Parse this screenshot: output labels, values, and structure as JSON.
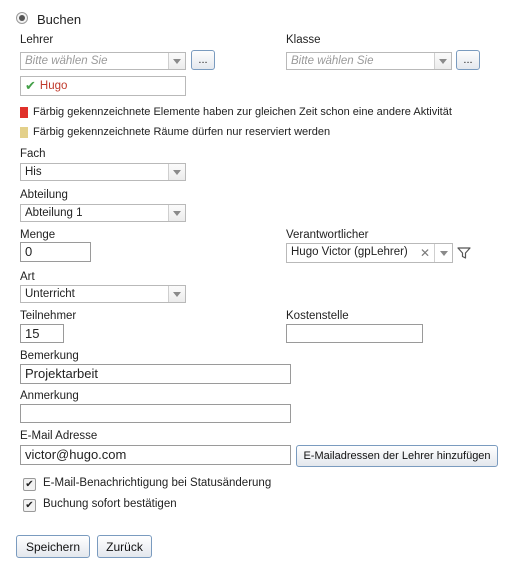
{
  "header": {
    "title": "Buchen"
  },
  "lehrer": {
    "label": "Lehrer",
    "placeholder": "Bitte wählen Sie",
    "browse_label": "...",
    "selected_tag": "Hugo"
  },
  "klasse": {
    "label": "Klasse",
    "placeholder": "Bitte wählen Sie",
    "browse_label": "..."
  },
  "legend": {
    "items": [
      {
        "text": "Färbig gekennzeichnete Elemente haben zur gleichen Zeit schon eine andere Aktivität",
        "color": "#e0302a"
      },
      {
        "text": "Färbig gekennzeichnete Räume dürfen nur reserviert werden",
        "color": "#e3d08a"
      }
    ]
  },
  "fach": {
    "label": "Fach",
    "value": "His"
  },
  "abteilung": {
    "label": "Abteilung",
    "value": "Abteilung 1"
  },
  "menge": {
    "label": "Menge",
    "value": "0"
  },
  "verantwortlicher": {
    "label": "Verantwortlicher",
    "value": "Hugo Victor (gpLehrer)"
  },
  "art": {
    "label": "Art",
    "value": "Unterricht"
  },
  "teilnehmer": {
    "label": "Teilnehmer",
    "value": "15"
  },
  "kostenstelle": {
    "label": "Kostenstelle",
    "value": ""
  },
  "bemerkung": {
    "label": "Bemerkung",
    "value": "Projektarbeit"
  },
  "anmerkung": {
    "label": "Anmerkung",
    "value": ""
  },
  "email": {
    "label": "E-Mail Adresse",
    "value": "victor@hugo.com",
    "add_button_label": "E-Mailadressen der Lehrer hinzufügen"
  },
  "options": {
    "notify_label": "E-Mail-Benachrichtigung bei Statusänderung",
    "notify_checked": true,
    "confirm_label": "Buchung sofort bestätigen",
    "confirm_checked": true
  },
  "actions": {
    "save_label": "Speichern",
    "back_label": "Zurück"
  },
  "colors": {
    "accent_border": "#7a9bbf",
    "conflict": "#e0302a",
    "reserved": "#e3d08a",
    "ok_check": "#43a047"
  }
}
